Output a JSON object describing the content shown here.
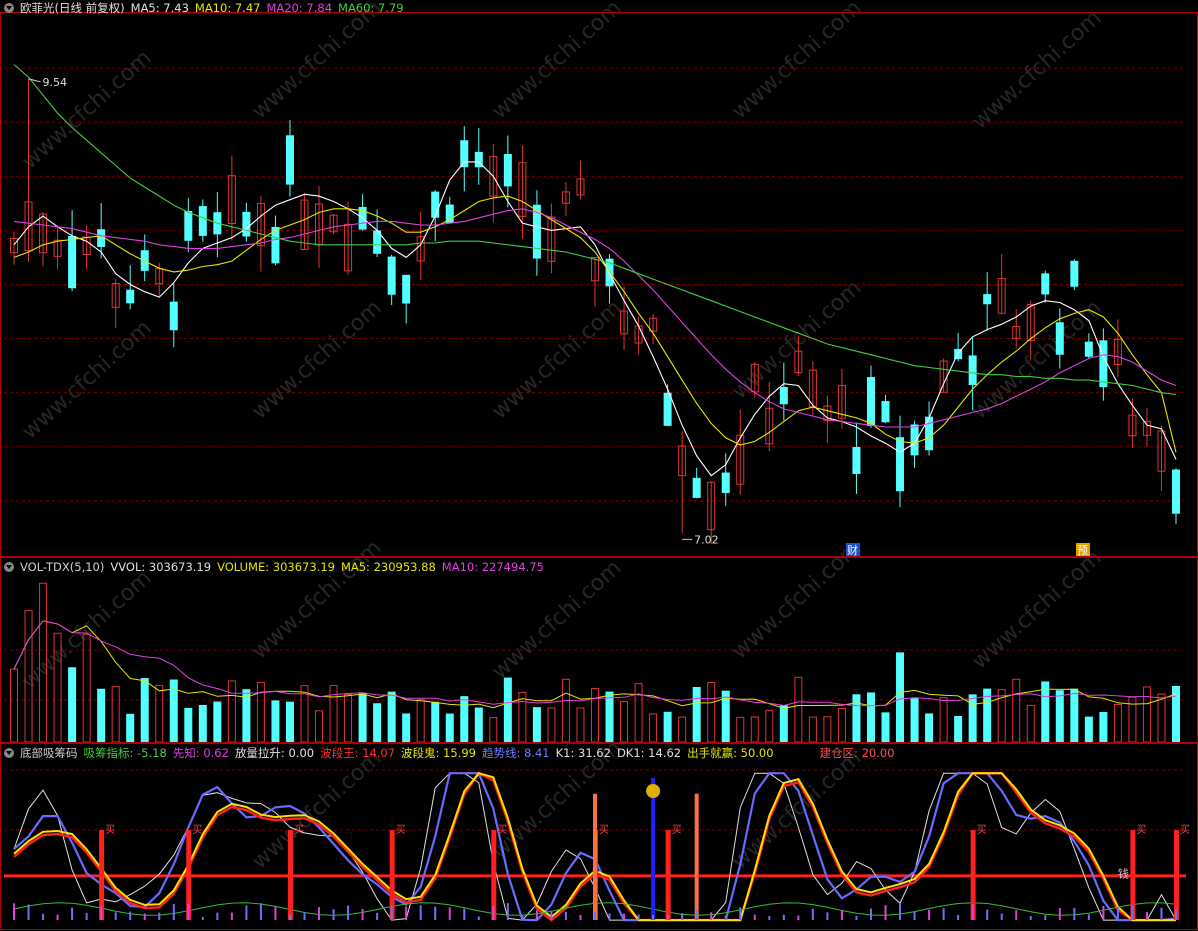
{
  "colors": {
    "bg": "#000000",
    "grid": "#7a0000",
    "frame": "#b00000",
    "up": "#e03434",
    "down": "#54ffff",
    "ma5": "#ffffff",
    "ma10": "#e6e600",
    "ma20": "#e040e0",
    "ma60": "#40d040"
  },
  "top_header": {
    "stock": "欧菲光(日线 前复权)",
    "ma5": "MA5: 7.43",
    "ma10": "MA10: 7.47",
    "ma20": "MA20: 7.84",
    "ma60": "MA60: 7.79"
  },
  "price_labels": {
    "high": "9.54",
    "low": "7.02"
  },
  "event_labels": [
    "财",
    "预"
  ],
  "volume_header": {
    "name": "VOL-TDX(5,10)",
    "vvol": "VVOL: 303673.19",
    "volume": "VOLUME: 303673.19",
    "ma5": "MA5: 230953.88",
    "ma10": "MA10: 227494.75"
  },
  "indicator_header": {
    "name": "底部吸筹码",
    "xczb": "吸筹指标: -5.18",
    "xz": "先知: 0.62",
    "flls": "放量拉升: 0.00",
    "bdw": "波段王: 14.07",
    "bdg": "波段鬼: 15.99",
    "qsx": "趋势线: 8.41",
    "k1": "K1: 31.62",
    "dk1": "DK1: 14.62",
    "cssy": "出手就赢: 50.00",
    "jcq": "建仓区: 20.00"
  },
  "signal_labels": {
    "buy": "买",
    "sell": "钱"
  },
  "watermark": "www.cfchi.com",
  "chart_data": [
    {
      "type": "candlestick",
      "title": "欧菲光(日线 前复权)",
      "ylim": [
        6.9,
        9.9
      ],
      "annotations": [
        {
          "label": "9.54",
          "value": 9.54
        },
        {
          "label": "7.02",
          "value": 7.02
        }
      ],
      "series": [
        {
          "name": "MA5",
          "values": [
            8.62,
            8.72,
            8.78,
            8.72,
            8.67,
            8.64,
            8.58,
            8.46,
            8.4,
            8.36,
            8.33,
            8.41,
            8.52,
            8.6,
            8.63,
            8.66,
            8.71,
            8.78,
            8.84,
            8.87,
            8.9,
            8.89,
            8.86,
            8.82,
            8.77,
            8.7,
            8.6,
            8.55,
            8.62,
            8.78,
            8.98,
            9.08,
            9.08,
            9.0,
            8.86,
            8.74,
            8.72,
            8.7,
            8.71,
            8.72,
            8.62,
            8.46,
            8.31,
            8.17,
            8.0,
            7.82,
            7.62,
            7.45,
            7.34,
            7.4,
            7.55,
            7.68,
            7.78,
            7.85,
            7.84,
            7.73,
            7.66,
            7.64,
            7.61,
            7.56,
            7.52,
            7.47,
            7.52,
            7.66,
            7.85,
            8.02,
            8.11,
            8.15,
            8.18,
            8.22,
            8.28,
            8.31,
            8.3,
            8.26,
            8.2,
            8.0,
            7.85,
            7.73,
            7.62,
            7.6,
            7.43
          ]
        },
        {
          "name": "MA10",
          "values": [
            8.55,
            8.58,
            8.62,
            8.64,
            8.65,
            8.66,
            8.67,
            8.62,
            8.57,
            8.53,
            8.49,
            8.47,
            8.48,
            8.5,
            8.51,
            8.53,
            8.59,
            8.65,
            8.7,
            8.73,
            8.76,
            8.8,
            8.82,
            8.82,
            8.81,
            8.78,
            8.74,
            8.69,
            8.69,
            8.72,
            8.76,
            8.81,
            8.86,
            8.88,
            8.89,
            8.86,
            8.81,
            8.76,
            8.71,
            8.66,
            8.58,
            8.47,
            8.36,
            8.24,
            8.13,
            8.0,
            7.87,
            7.74,
            7.63,
            7.55,
            7.51,
            7.53,
            7.58,
            7.64,
            7.7,
            7.72,
            7.7,
            7.68,
            7.66,
            7.63,
            7.57,
            7.53,
            7.52,
            7.55,
            7.62,
            7.72,
            7.82,
            7.9,
            7.97,
            8.03,
            8.1,
            8.16,
            8.21,
            8.24,
            8.26,
            8.22,
            8.13,
            8.01,
            7.9,
            7.8,
            7.47
          ]
        },
        {
          "name": "MA20",
          "values": [
            8.75,
            8.74,
            8.73,
            8.72,
            8.71,
            8.69,
            8.67,
            8.66,
            8.65,
            8.64,
            8.62,
            8.61,
            8.6,
            8.6,
            8.6,
            8.61,
            8.62,
            8.63,
            8.65,
            8.66,
            8.68,
            8.7,
            8.72,
            8.73,
            8.74,
            8.75,
            8.75,
            8.74,
            8.73,
            8.73,
            8.74,
            8.75,
            8.77,
            8.79,
            8.81,
            8.82,
            8.8,
            8.77,
            8.73,
            8.69,
            8.65,
            8.6,
            8.53,
            8.45,
            8.37,
            8.28,
            8.19,
            8.1,
            8.01,
            7.93,
            7.86,
            7.8,
            7.75,
            7.71,
            7.69,
            7.67,
            7.65,
            7.64,
            7.63,
            7.62,
            7.61,
            7.61,
            7.61,
            7.63,
            7.65,
            7.67,
            7.69,
            7.71,
            7.74,
            7.78,
            7.82,
            7.86,
            7.91,
            7.95,
            7.99,
            8.01,
            8.0,
            7.97,
            7.92,
            7.87,
            7.84
          ]
        },
        {
          "name": "MA60",
          "values": [
            9.62,
            9.55,
            9.45,
            9.35,
            9.27,
            9.2,
            9.13,
            9.06,
            8.99,
            8.94,
            8.89,
            8.84,
            8.8,
            8.77,
            8.74,
            8.72,
            8.7,
            8.68,
            8.66,
            8.64,
            8.63,
            8.62,
            8.62,
            8.62,
            8.62,
            8.62,
            8.62,
            8.62,
            8.63,
            8.63,
            8.64,
            8.64,
            8.64,
            8.63,
            8.62,
            8.61,
            8.6,
            8.59,
            8.58,
            8.56,
            8.54,
            8.52,
            8.49,
            8.46,
            8.43,
            8.4,
            8.37,
            8.34,
            8.31,
            8.28,
            8.25,
            8.22,
            8.19,
            8.16,
            8.13,
            8.1,
            8.07,
            8.05,
            8.03,
            8.01,
            7.99,
            7.97,
            7.95,
            7.94,
            7.93,
            7.92,
            7.91,
            7.9,
            7.9,
            7.89,
            7.89,
            7.88,
            7.88,
            7.87,
            7.87,
            7.86,
            7.85,
            7.84,
            7.82,
            7.8,
            7.79
          ]
        }
      ]
    },
    {
      "type": "bar",
      "title": "VOL-TDX(5,10)",
      "series": [
        {
          "name": "MA5"
        },
        {
          "name": "MA10"
        }
      ]
    },
    {
      "type": "line",
      "title": "底部吸筹码",
      "series": [
        {
          "name": "吸筹指标"
        },
        {
          "name": "先知"
        },
        {
          "name": "波段王"
        },
        {
          "name": "波段鬼"
        },
        {
          "name": "趋势线"
        },
        {
          "name": "K1"
        },
        {
          "name": "DK1"
        },
        {
          "name": "出手就赢"
        },
        {
          "name": "建仓区"
        }
      ]
    }
  ]
}
